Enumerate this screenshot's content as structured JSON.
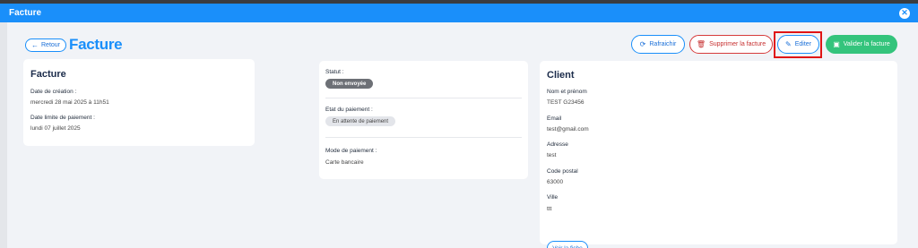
{
  "modal": {
    "title": "Facture"
  },
  "header": {
    "back_label": "Retour",
    "page_title": "Facture"
  },
  "toolbar": {
    "refresh_label": "Rafraichir",
    "delete_label": "Supprimer la facture",
    "edit_label": "Editer",
    "validate_label": "Valider la facture"
  },
  "invoice": {
    "title": "Facture",
    "created_label": "Date de création :",
    "created_value": "mercredi 28 mai 2025 à 11h51",
    "due_label": "Date limite de paiement :",
    "due_value": "lundi 07 juillet 2025"
  },
  "status": {
    "status_label": "Statut :",
    "status_value": "Non envoyée",
    "payment_state_label": "Etat du paiement :",
    "payment_state_value": "En attente de paiement",
    "payment_mode_label": "Mode de paiement :",
    "payment_mode_value": "Carte bancaire"
  },
  "client": {
    "title": "Client",
    "name_label": "Nom et prénom",
    "name_value": "TEST G23456",
    "email_label": "Email",
    "email_value": "test@gmail.com",
    "address_label": "Adresse",
    "address_value": "test",
    "postal_label": "Code postal",
    "postal_value": "63000",
    "city_label": "Ville",
    "city_value": "ttt",
    "view_label": "Voir la fiche"
  },
  "colors": {
    "primary": "#1a8ffa",
    "danger": "#d63b3b",
    "success": "#34c47c",
    "highlight": "#e01515"
  }
}
